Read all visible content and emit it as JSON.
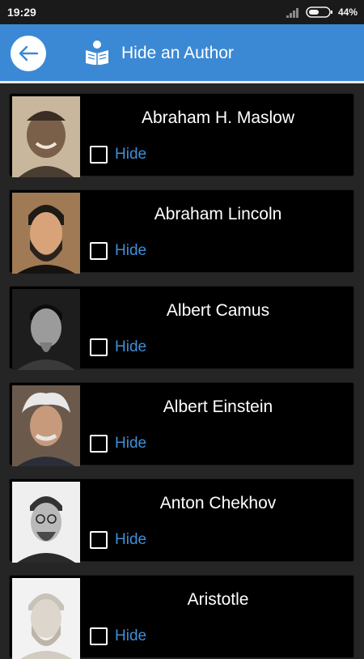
{
  "status_bar": {
    "time": "19:29",
    "battery_percent": "44%"
  },
  "app_bar": {
    "title": "Hide an Author"
  },
  "authors": [
    {
      "name": "Abraham H. Maslow",
      "hide_label": "Hide",
      "hidden": false
    },
    {
      "name": "Abraham Lincoln",
      "hide_label": "Hide",
      "hidden": false
    },
    {
      "name": "Albert Camus",
      "hide_label": "Hide",
      "hidden": false
    },
    {
      "name": "Albert Einstein",
      "hide_label": "Hide",
      "hidden": false
    },
    {
      "name": "Anton Chekhov",
      "hide_label": "Hide",
      "hidden": false
    },
    {
      "name": "Aristotle",
      "hide_label": "Hide",
      "hidden": false
    }
  ],
  "colors": {
    "app_bar": "#3b89d4",
    "accent": "#3d8fd8",
    "background": "#252525",
    "card": "#000000"
  }
}
